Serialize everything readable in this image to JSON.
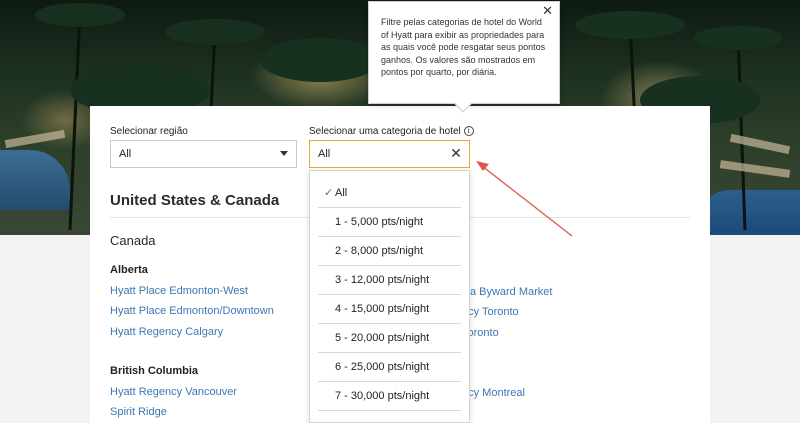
{
  "filters": {
    "region_label": "Selecionar região",
    "region_value": "All",
    "category_label": "Selecionar uma categoria de hotel",
    "category_value": "All",
    "info_symbol": "i"
  },
  "tooltip": {
    "text": "Filtre pelas categorias de hotel do World of Hyatt para exibir as propriedades para as quais você pode resgatar seus pontos ganhos. Os valores são mostrados em pontos por quarto, por diária.",
    "close_symbol": "✕"
  },
  "dropdown": {
    "clear_symbol": "✕",
    "check_symbol": "✓",
    "options": [
      "All",
      "1 - 5,000 pts/night",
      "2 - 8,000 pts/night",
      "3 - 12,000 pts/night",
      "4 - 15,000 pts/night",
      "5 - 20,000 pts/night",
      "6 - 25,000 pts/night",
      "7 - 30,000 pts/night"
    ]
  },
  "listing": {
    "section_title": "United States & Canada",
    "country": "Canada",
    "regions": [
      {
        "name": "Alberta",
        "hotels": [
          "Hyatt Place Edmonton-West",
          "Hyatt Place Edmonton/Downtown",
          "Hyatt Regency Calgary"
        ]
      },
      {
        "name": "British Columbia",
        "hotels": [
          "Hyatt Regency Vancouver",
          "Spirit Ridge"
        ]
      }
    ],
    "partial_right_links": [
      "wa Byward Market",
      "ncy Toronto",
      "Toronto",
      "ncy Montreal"
    ]
  },
  "colors": {
    "link": "#3a78b5",
    "accent_border": "#e5a83a",
    "annotation_arrow": "#e0584a"
  }
}
